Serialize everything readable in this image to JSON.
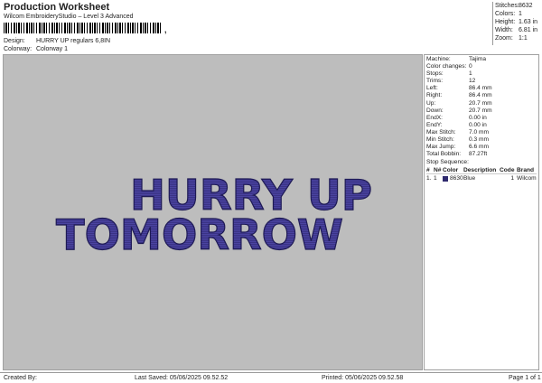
{
  "header": {
    "title": "Production Worksheet",
    "subtitle": "Wilcom EmbroideryStudio – Level 3 Advanced",
    "barcode_suffix": ","
  },
  "design": {
    "label": "Design:",
    "value": "HURRY UP regulars 6,8IN"
  },
  "colorway": {
    "label": "Colorway:",
    "value": "Colorway 1"
  },
  "summary": [
    {
      "key": "Stitches:",
      "value": "8632"
    },
    {
      "key": "Colors:",
      "value": "1"
    },
    {
      "key": "Height:",
      "value": "1.63 in"
    },
    {
      "key": "Width:",
      "value": "6.81 in"
    },
    {
      "key": "Zoom:",
      "value": "1:1"
    }
  ],
  "preview": {
    "line1": "HURRY UP",
    "line2": "TOMORROW",
    "thread_color": "#3a3385",
    "background": "#bdbdbd"
  },
  "machine_info": [
    {
      "key": "Machine:",
      "value": "Tajima"
    },
    {
      "key": "Color changes:",
      "value": "0"
    },
    {
      "key": "Stops:",
      "value": "1"
    },
    {
      "key": "Trims:",
      "value": "12"
    },
    {
      "key": "Left:",
      "value": "86.4 mm"
    },
    {
      "key": "Right:",
      "value": "86.4 mm"
    },
    {
      "key": "Up:",
      "value": "20.7 mm"
    },
    {
      "key": "Down:",
      "value": "20.7 mm"
    },
    {
      "key": "EndX:",
      "value": "0.00 in"
    },
    {
      "key": "EndY:",
      "value": "0.00 in"
    },
    {
      "key": "Max Stitch:",
      "value": "7.0 mm"
    },
    {
      "key": "Min Stitch:",
      "value": "0.3 mm"
    },
    {
      "key": "Max Jump:",
      "value": "6.6 mm"
    },
    {
      "key": "Total Bobbin:",
      "value": "87.27ft"
    }
  ],
  "stop_sequence": {
    "label": "Stop Sequence:",
    "headers": [
      "#",
      "N#",
      "Color",
      "Description",
      "Code",
      "Brand"
    ],
    "rows": [
      {
        "num": "1.",
        "n": "1",
        "color": "8630",
        "desc": "Blue",
        "code": "1",
        "brand": "Wilcom"
      }
    ]
  },
  "footer": {
    "created_by": "Created By:",
    "last_saved": "Last Saved: 05/06/2025 09.52.52",
    "printed": "Printed: 05/06/2025 09.52.58",
    "page": "Page 1 of 1"
  }
}
